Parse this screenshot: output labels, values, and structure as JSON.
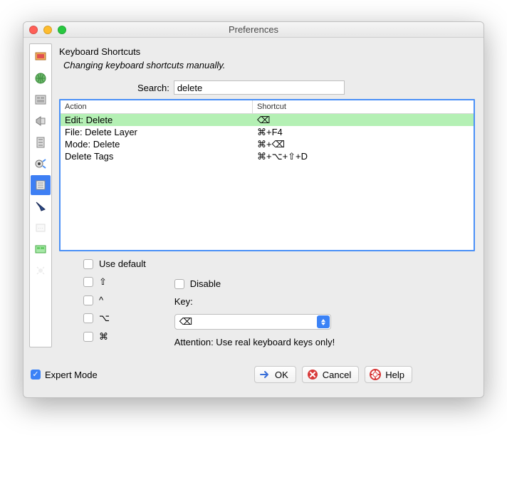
{
  "window": {
    "title": "Preferences"
  },
  "page": {
    "heading": "Keyboard Shortcuts",
    "subheading": "Changing keyboard shortcuts manually."
  },
  "search": {
    "label": "Search:",
    "value": "delete"
  },
  "table": {
    "columns": {
      "action": "Action",
      "shortcut": "Shortcut"
    },
    "rows": [
      {
        "action": "Edit: Delete",
        "shortcut": "⌫",
        "selected": true
      },
      {
        "action": "File: Delete Layer",
        "shortcut": "⌘+F4",
        "selected": false
      },
      {
        "action": "Mode: Delete",
        "shortcut": "⌘+⌫",
        "selected": false
      },
      {
        "action": "Delete Tags",
        "shortcut": "⌘+⌥+⇧+D",
        "selected": false
      }
    ]
  },
  "options": {
    "use_default_label": "Use default",
    "shift_label": "⇧",
    "ctrl_label": "^",
    "alt_label": "⌥",
    "cmd_label": "⌘",
    "disable_label": "Disable",
    "key_label": "Key:",
    "key_value": "⌫",
    "warning": "Attention: Use real keyboard keys only!"
  },
  "footer": {
    "expert_label": "Expert Mode",
    "ok": "OK",
    "cancel": "Cancel",
    "help": "Help"
  }
}
